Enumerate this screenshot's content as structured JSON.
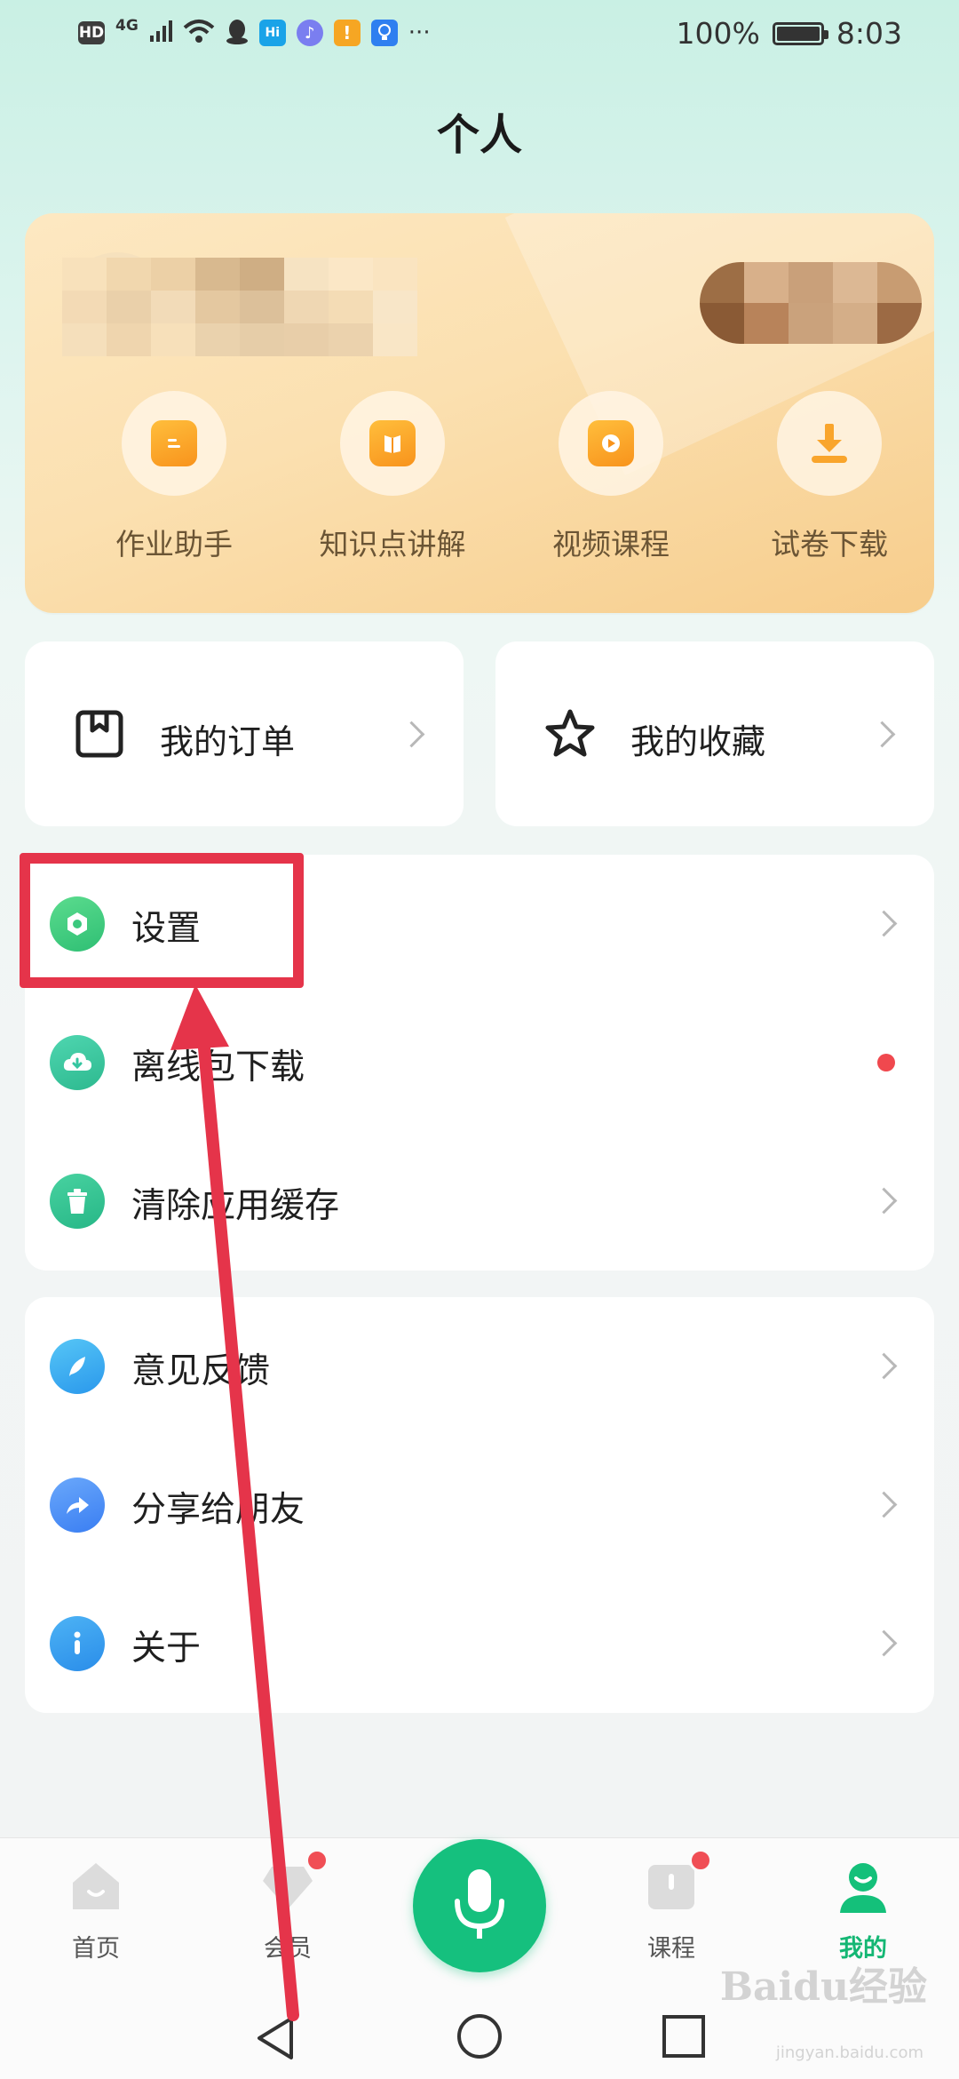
{
  "status_bar": {
    "battery": "100%",
    "time": "8:03",
    "network": "4G",
    "hd": "HD",
    "more": "···",
    "hi_label": "Hi"
  },
  "page_title": "个人",
  "profile": {
    "quick_actions": [
      {
        "label": "作业助手",
        "icon": "homework-icon"
      },
      {
        "label": "知识点讲解",
        "icon": "book-icon"
      },
      {
        "label": "视频课程",
        "icon": "play-icon"
      },
      {
        "label": "试卷下载",
        "icon": "download-icon"
      }
    ]
  },
  "shortcuts": {
    "orders": "我的订单",
    "favorites": "我的收藏"
  },
  "menu_group_1": [
    {
      "label": "设置",
      "icon": "settings-icon",
      "color": "#3fcf7e"
    },
    {
      "label": "离线包下载",
      "icon": "cloud-download-icon",
      "color": "#35c6a0"
    },
    {
      "label": "清除应用缓存",
      "icon": "trash-icon",
      "color": "#2fbf8f"
    }
  ],
  "menu_group_2": [
    {
      "label": "意见反馈",
      "icon": "feather-icon",
      "color": "#2fa9f0"
    },
    {
      "label": "分享给朋友",
      "icon": "share-icon",
      "color": "#3d8ff6"
    },
    {
      "label": "关于",
      "icon": "info-icon",
      "color": "#2a9bef"
    }
  ],
  "tabs": [
    {
      "label": "首页",
      "icon": "home-icon"
    },
    {
      "label": "会员",
      "icon": "diamond-icon"
    },
    {
      "label": "课程",
      "icon": "course-icon"
    },
    {
      "label": "我的",
      "icon": "profile-icon",
      "active": true
    }
  ],
  "colors": {
    "accent": "#15c07e",
    "highlight": "#e5344a",
    "badge": "#f04e55"
  },
  "watermark": {
    "main": "Baidu经验",
    "sub": "jingyan.baidu.com"
  }
}
